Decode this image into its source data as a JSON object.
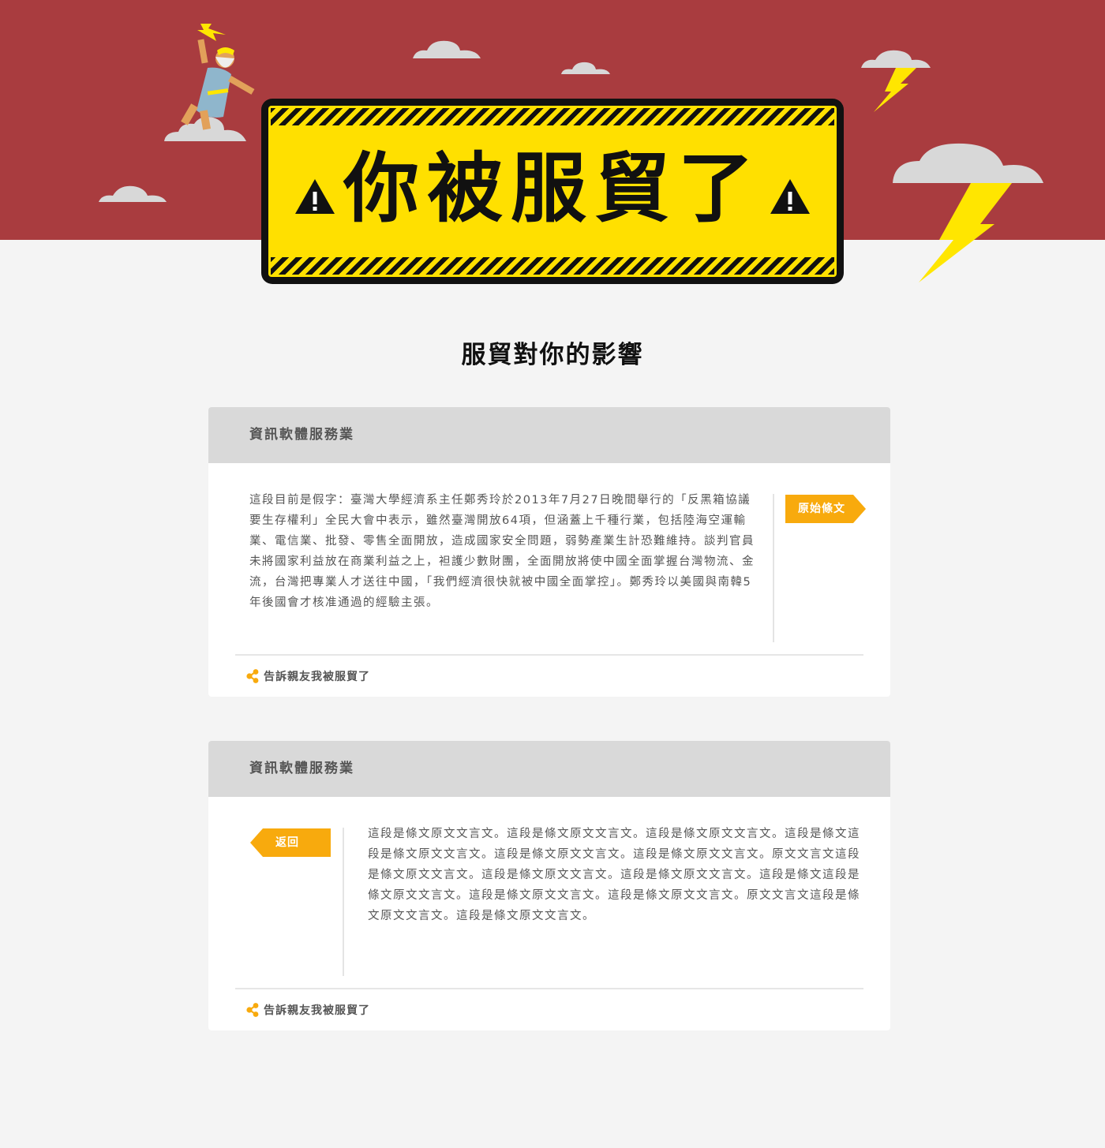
{
  "hero": {
    "sign_title": "你被服貿了",
    "warning_icon": "warning-triangle-icon",
    "colors": {
      "background": "#a93c3f",
      "sign": "#ffe000",
      "bolt": "#ffe600",
      "cloud": "#d8d8d8"
    }
  },
  "section": {
    "title": "服貿對你的影響"
  },
  "cards": [
    {
      "header": "資訊軟體服務業",
      "body": "這段目前是假字：臺灣大學經濟系主任鄭秀玲於2013年7月27日晚間舉行的「反黑箱協議要生存權利」全民大會中表示，雖然臺灣開放64項，但涵蓋上千種行業，包括陸海空運輸業、電信業、批發、零售全面開放，造成國家安全問題，弱勢產業生計恐難維持。談判官員未將國家利益放在商業利益之上，袒護少數財團，全面開放將使中國全面掌握台灣物流、金流，台灣把專業人才送往中國，「我們經濟很快就被中國全面掌控」。鄭秀玲以美國與南韓5年後國會才核准通過的經驗主張。",
      "tag": "原始條文",
      "share": "告訴親友我被服貿了"
    },
    {
      "header": "資訊軟體服務業",
      "body": "這段是條文原文文言文。這段是條文原文文言文。這段是條文原文文言文。這段是條文這段是條文原文文言文。這段是條文原文文言文。這段是條文原文文言文。原文文言文這段是條文原文文言文。這段是條文原文文言文。這段是條文原文文言文。這段是條文這段是條文原文文言文。這段是條文原文文言文。這段是條文原文文言文。原文文言文這段是條文原文文言文。這段是條文原文文言文。",
      "tag": "返回",
      "share": "告訴親友我被服貿了"
    }
  ],
  "icons": {
    "share": "share-icon",
    "accent": "#f8aa0d"
  }
}
